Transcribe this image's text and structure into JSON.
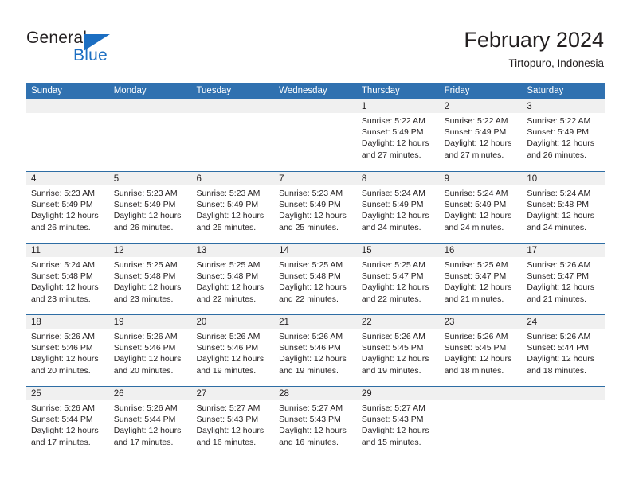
{
  "brand": {
    "name_part1": "General",
    "name_part2": "Blue",
    "logo_icon": "triangle-logo-icon"
  },
  "header": {
    "title": "February 2024",
    "location": "Tirtopuro, Indonesia"
  },
  "calendar": {
    "weekdays": [
      "Sunday",
      "Monday",
      "Tuesday",
      "Wednesday",
      "Thursday",
      "Friday",
      "Saturday"
    ],
    "accent_color": "#3071b0",
    "band_color": "#f0f0f0",
    "separator_color": "#2e6da4",
    "weeks": [
      [
        {
          "day": "",
          "lines": []
        },
        {
          "day": "",
          "lines": []
        },
        {
          "day": "",
          "lines": []
        },
        {
          "day": "",
          "lines": []
        },
        {
          "day": "1",
          "lines": [
            "Sunrise: 5:22 AM",
            "Sunset: 5:49 PM",
            "Daylight: 12 hours",
            "and 27 minutes."
          ]
        },
        {
          "day": "2",
          "lines": [
            "Sunrise: 5:22 AM",
            "Sunset: 5:49 PM",
            "Daylight: 12 hours",
            "and 27 minutes."
          ]
        },
        {
          "day": "3",
          "lines": [
            "Sunrise: 5:22 AM",
            "Sunset: 5:49 PM",
            "Daylight: 12 hours",
            "and 26 minutes."
          ]
        }
      ],
      [
        {
          "day": "4",
          "lines": [
            "Sunrise: 5:23 AM",
            "Sunset: 5:49 PM",
            "Daylight: 12 hours",
            "and 26 minutes."
          ]
        },
        {
          "day": "5",
          "lines": [
            "Sunrise: 5:23 AM",
            "Sunset: 5:49 PM",
            "Daylight: 12 hours",
            "and 26 minutes."
          ]
        },
        {
          "day": "6",
          "lines": [
            "Sunrise: 5:23 AM",
            "Sunset: 5:49 PM",
            "Daylight: 12 hours",
            "and 25 minutes."
          ]
        },
        {
          "day": "7",
          "lines": [
            "Sunrise: 5:23 AM",
            "Sunset: 5:49 PM",
            "Daylight: 12 hours",
            "and 25 minutes."
          ]
        },
        {
          "day": "8",
          "lines": [
            "Sunrise: 5:24 AM",
            "Sunset: 5:49 PM",
            "Daylight: 12 hours",
            "and 24 minutes."
          ]
        },
        {
          "day": "9",
          "lines": [
            "Sunrise: 5:24 AM",
            "Sunset: 5:49 PM",
            "Daylight: 12 hours",
            "and 24 minutes."
          ]
        },
        {
          "day": "10",
          "lines": [
            "Sunrise: 5:24 AM",
            "Sunset: 5:48 PM",
            "Daylight: 12 hours",
            "and 24 minutes."
          ]
        }
      ],
      [
        {
          "day": "11",
          "lines": [
            "Sunrise: 5:24 AM",
            "Sunset: 5:48 PM",
            "Daylight: 12 hours",
            "and 23 minutes."
          ]
        },
        {
          "day": "12",
          "lines": [
            "Sunrise: 5:25 AM",
            "Sunset: 5:48 PM",
            "Daylight: 12 hours",
            "and 23 minutes."
          ]
        },
        {
          "day": "13",
          "lines": [
            "Sunrise: 5:25 AM",
            "Sunset: 5:48 PM",
            "Daylight: 12 hours",
            "and 22 minutes."
          ]
        },
        {
          "day": "14",
          "lines": [
            "Sunrise: 5:25 AM",
            "Sunset: 5:48 PM",
            "Daylight: 12 hours",
            "and 22 minutes."
          ]
        },
        {
          "day": "15",
          "lines": [
            "Sunrise: 5:25 AM",
            "Sunset: 5:47 PM",
            "Daylight: 12 hours",
            "and 22 minutes."
          ]
        },
        {
          "day": "16",
          "lines": [
            "Sunrise: 5:25 AM",
            "Sunset: 5:47 PM",
            "Daylight: 12 hours",
            "and 21 minutes."
          ]
        },
        {
          "day": "17",
          "lines": [
            "Sunrise: 5:26 AM",
            "Sunset: 5:47 PM",
            "Daylight: 12 hours",
            "and 21 minutes."
          ]
        }
      ],
      [
        {
          "day": "18",
          "lines": [
            "Sunrise: 5:26 AM",
            "Sunset: 5:46 PM",
            "Daylight: 12 hours",
            "and 20 minutes."
          ]
        },
        {
          "day": "19",
          "lines": [
            "Sunrise: 5:26 AM",
            "Sunset: 5:46 PM",
            "Daylight: 12 hours",
            "and 20 minutes."
          ]
        },
        {
          "day": "20",
          "lines": [
            "Sunrise: 5:26 AM",
            "Sunset: 5:46 PM",
            "Daylight: 12 hours",
            "and 19 minutes."
          ]
        },
        {
          "day": "21",
          "lines": [
            "Sunrise: 5:26 AM",
            "Sunset: 5:46 PM",
            "Daylight: 12 hours",
            "and 19 minutes."
          ]
        },
        {
          "day": "22",
          "lines": [
            "Sunrise: 5:26 AM",
            "Sunset: 5:45 PM",
            "Daylight: 12 hours",
            "and 19 minutes."
          ]
        },
        {
          "day": "23",
          "lines": [
            "Sunrise: 5:26 AM",
            "Sunset: 5:45 PM",
            "Daylight: 12 hours",
            "and 18 minutes."
          ]
        },
        {
          "day": "24",
          "lines": [
            "Sunrise: 5:26 AM",
            "Sunset: 5:44 PM",
            "Daylight: 12 hours",
            "and 18 minutes."
          ]
        }
      ],
      [
        {
          "day": "25",
          "lines": [
            "Sunrise: 5:26 AM",
            "Sunset: 5:44 PM",
            "Daylight: 12 hours",
            "and 17 minutes."
          ]
        },
        {
          "day": "26",
          "lines": [
            "Sunrise: 5:26 AM",
            "Sunset: 5:44 PM",
            "Daylight: 12 hours",
            "and 17 minutes."
          ]
        },
        {
          "day": "27",
          "lines": [
            "Sunrise: 5:27 AM",
            "Sunset: 5:43 PM",
            "Daylight: 12 hours",
            "and 16 minutes."
          ]
        },
        {
          "day": "28",
          "lines": [
            "Sunrise: 5:27 AM",
            "Sunset: 5:43 PM",
            "Daylight: 12 hours",
            "and 16 minutes."
          ]
        },
        {
          "day": "29",
          "lines": [
            "Sunrise: 5:27 AM",
            "Sunset: 5:43 PM",
            "Daylight: 12 hours",
            "and 15 minutes."
          ]
        },
        {
          "day": "",
          "lines": []
        },
        {
          "day": "",
          "lines": []
        }
      ]
    ]
  }
}
